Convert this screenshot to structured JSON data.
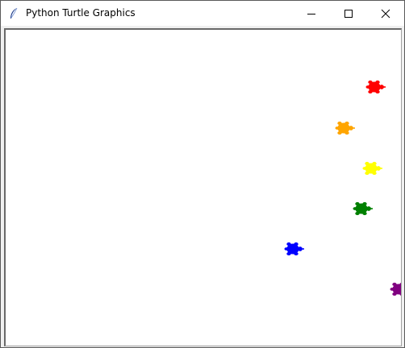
{
  "window": {
    "title": "Python Turtle Graphics",
    "icon": "feather-icon",
    "controls": [
      "minimize-icon",
      "maximize-icon",
      "close-icon"
    ]
  },
  "canvas": {
    "background": "#ffffff",
    "turtles": [
      {
        "name": "turtle-red",
        "color": "#ff0000",
        "icon": "turtle-icon"
      },
      {
        "name": "turtle-orange",
        "color": "#ffa500",
        "icon": "turtle-icon"
      },
      {
        "name": "turtle-yellow",
        "color": "#ffff00",
        "icon": "turtle-icon"
      },
      {
        "name": "turtle-green",
        "color": "#008000",
        "icon": "turtle-icon"
      },
      {
        "name": "turtle-blue",
        "color": "#0000ff",
        "icon": "turtle-icon"
      },
      {
        "name": "turtle-purple",
        "color": "#800080",
        "icon": "turtle-icon"
      }
    ]
  }
}
